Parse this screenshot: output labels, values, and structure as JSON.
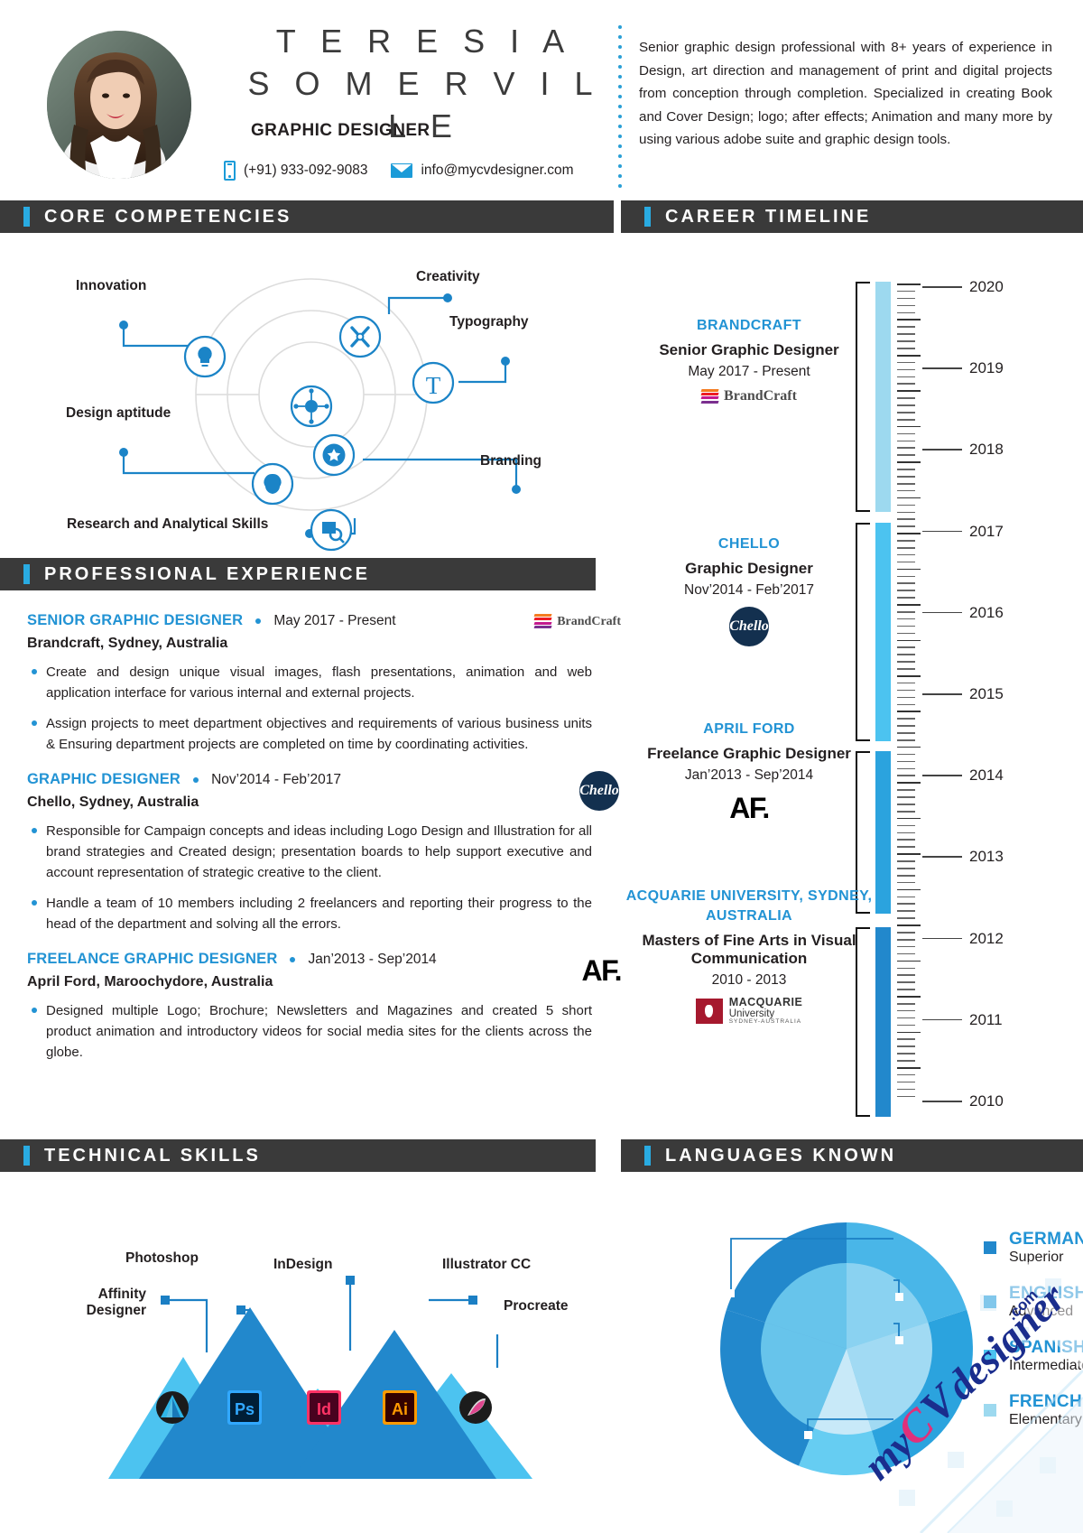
{
  "header": {
    "name_line1": "T E R E S I A",
    "name_line2": "S O M E R V I L L E",
    "job_title": "GRAPHIC DESIGNER",
    "phone": "(+91) 933-092-9083",
    "email": "info@mycvdesigner.com",
    "phone_icon": "phone-icon",
    "email_icon": "envelope-icon",
    "summary": "Senior graphic design professional with 8+ years of experience in Design, art direction and management of print and digital projects from conception through completion. Specialized in creating Book and Cover Design; logo; after effects; Animation and many more by using various adobe suite and graphic design tools."
  },
  "sections": {
    "core_competencies": "CORE COMPETENCIES",
    "career_timeline": "CAREER TIMELINE",
    "professional_experience": "PROFESSIONAL EXPERIENCE",
    "technical_skills": "TECHNICAL SKILLS",
    "languages_known": "LANGUAGES KNOWN"
  },
  "core_competencies": {
    "items": [
      {
        "label": "Innovation",
        "icon": "lightbulb-icon"
      },
      {
        "label": "Creativity",
        "icon": "compass-icon"
      },
      {
        "label": "Typography",
        "icon": "typography-t-icon"
      },
      {
        "label": "Design aptitude",
        "icon": "brain-circuit-icon"
      },
      {
        "label": "Branding",
        "icon": "star-badge-icon"
      },
      {
        "label": "Research and Analytical Skills",
        "icon": "chart-magnifier-icon"
      }
    ],
    "center_icon": "network-hub-icon"
  },
  "experience": [
    {
      "role": "SENIOR GRAPHIC DESIGNER",
      "dates": "May 2017 - Present",
      "org": "Brandcraft, Sydney, Australia",
      "logo": "brandcraft-logo",
      "logo_text": "BrandCraft",
      "bullets": [
        "Create and design unique visual images, flash presentations, animation and web application interface for various internal and external projects.",
        "Assign projects to meet department objectives and requirements of various business units & Ensuring department projects are completed on time by coordinating activities."
      ]
    },
    {
      "role": "GRAPHIC DESIGNER",
      "dates": "Nov’2014 - Feb’2017",
      "org": "Chello, Sydney, Australia",
      "logo": "chello-logo",
      "logo_text": "Chello",
      "bullets": [
        "Responsible for Campaign concepts and ideas including Logo Design and Illustration for all brand strategies and Created design; presentation boards to help support executive and account representation of strategic creative to the client.",
        "Handle a team of 10 members including 2 freelancers and reporting their progress to the head of the department and solving all the errors."
      ]
    },
    {
      "role": "FREELANCE GRAPHIC DESIGNER",
      "dates": "Jan’2013 - Sep’2014",
      "org": "April Ford, Maroochydore, Australia",
      "logo": "april-ford-logo",
      "logo_text": "AF.",
      "bullets": [
        "Designed multiple Logo; Brochure; Newsletters and Magazines and created 5 short product animation and introductory videos for social media sites for the clients across the globe."
      ]
    }
  ],
  "timeline": {
    "years": [
      "2020",
      "2019",
      "2018",
      "2017",
      "2016",
      "2015",
      "2014",
      "2013",
      "2012",
      "2011",
      "2010"
    ],
    "entries": [
      {
        "org": "BRANDCRAFT",
        "role": "Senior Graphic Designer",
        "dates": "May 2017 - Present",
        "logo": "brandcraft-logo",
        "logo_text": "BrandCraft",
        "bar_color": "#9dd9ef"
      },
      {
        "org": "CHELLO",
        "role": "Graphic Designer",
        "dates": "Nov’2014 - Feb’2017",
        "logo": "chello-logo",
        "logo_text": "Chello",
        "bar_color": "#4cc3f0"
      },
      {
        "org": "APRIL FORD",
        "role": "Freelance Graphic Designer",
        "dates": "Jan’2013 - Sep’2014",
        "logo": "april-ford-logo",
        "logo_text": "AF.",
        "bar_color": "#2ba3de"
      },
      {
        "org": "ACQUARIE UNIVERSITY, SYDNEY, AUSTRALIA",
        "role": "Masters of Fine Arts in Visual Communication",
        "dates": "2010 - 2013",
        "logo": "macquarie-university-logo",
        "logo_text": "MACQUARIE University SYDNEY-AUSTRALIA",
        "bar_color": "#2288cc"
      }
    ]
  },
  "chart_data": [
    {
      "type": "bar",
      "title": "Technical Skills",
      "categories": [
        "Affinity Designer",
        "Photoshop",
        "InDesign",
        "Illustrator CC",
        "Procreate"
      ],
      "values": [
        70,
        100,
        58,
        88,
        62
      ],
      "ylim": [
        0,
        100
      ],
      "xlabel": "",
      "ylabel": "",
      "grid": false,
      "legend": "none",
      "annotations": [
        "Affinity Designer",
        "Photoshop",
        "InDesign",
        "Illustrator CC",
        "Procreate"
      ],
      "icons": [
        "affinity-designer-icon",
        "photoshop-icon",
        "indesign-icon",
        "illustrator-icon",
        "procreate-icon"
      ]
    },
    {
      "type": "pie",
      "title": "Languages Known",
      "categories": [
        "GERMAN",
        "ENGLISH",
        "SPANISH",
        "FRENCH"
      ],
      "values": [
        40,
        25,
        20,
        15
      ],
      "levels": [
        "Superior",
        "Advanced",
        "Intermediate",
        "Elementary"
      ],
      "colors": [
        "#2288cc",
        "#2ba3de",
        "#4cc3f0",
        "#9dd9ef"
      ],
      "legend": "right"
    }
  ],
  "technical_skills": {
    "items": [
      {
        "label": "Affinity Designer",
        "icon": "affinity-designer-icon"
      },
      {
        "label": "Photoshop",
        "icon": "photoshop-icon"
      },
      {
        "label": "InDesign",
        "icon": "indesign-icon"
      },
      {
        "label": "Illustrator CC",
        "icon": "illustrator-icon"
      },
      {
        "label": "Procreate",
        "icon": "procreate-icon"
      }
    ]
  },
  "languages": {
    "items": [
      {
        "name": "GERMAN",
        "level": "Superior",
        "color": "#2288cc"
      },
      {
        "name": "ENGLISH",
        "level": "Advanced",
        "color": "#2ba3de"
      },
      {
        "name": "SPANISH",
        "level": "Intermediate",
        "color": "#4cc3f0"
      },
      {
        "name": "FRENCH",
        "level": "Elementary",
        "color": "#9dd9ef"
      }
    ]
  },
  "watermark": {
    "text": "myCVdesigner",
    "suffix": ".com"
  },
  "colors": {
    "accent": "#29abe2",
    "blue": "#2293d4",
    "dark_bar": "#3a3a3a"
  }
}
